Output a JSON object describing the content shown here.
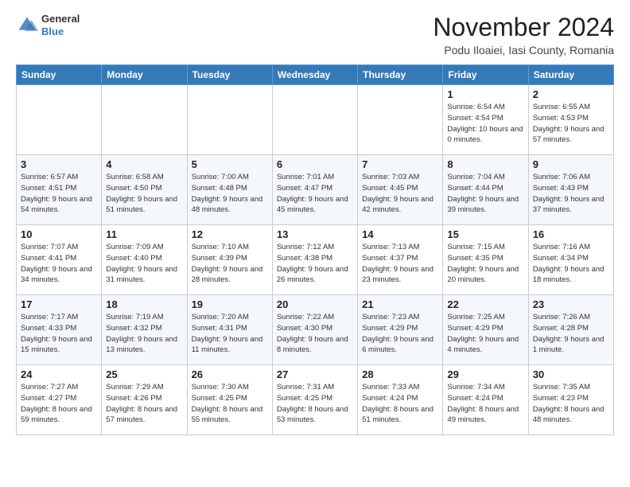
{
  "header": {
    "logo": {
      "general": "General",
      "blue": "Blue"
    },
    "title": "November 2024",
    "location": "Podu Iloaiei, Iasi County, Romania"
  },
  "days_of_week": [
    "Sunday",
    "Monday",
    "Tuesday",
    "Wednesday",
    "Thursday",
    "Friday",
    "Saturday"
  ],
  "weeks": [
    [
      {
        "day": "",
        "info": ""
      },
      {
        "day": "",
        "info": ""
      },
      {
        "day": "",
        "info": ""
      },
      {
        "day": "",
        "info": ""
      },
      {
        "day": "",
        "info": ""
      },
      {
        "day": "1",
        "info": "Sunrise: 6:54 AM\nSunset: 4:54 PM\nDaylight: 10 hours\nand 0 minutes."
      },
      {
        "day": "2",
        "info": "Sunrise: 6:55 AM\nSunset: 4:53 PM\nDaylight: 9 hours\nand 57 minutes."
      }
    ],
    [
      {
        "day": "3",
        "info": "Sunrise: 6:57 AM\nSunset: 4:51 PM\nDaylight: 9 hours\nand 54 minutes."
      },
      {
        "day": "4",
        "info": "Sunrise: 6:58 AM\nSunset: 4:50 PM\nDaylight: 9 hours\nand 51 minutes."
      },
      {
        "day": "5",
        "info": "Sunrise: 7:00 AM\nSunset: 4:48 PM\nDaylight: 9 hours\nand 48 minutes."
      },
      {
        "day": "6",
        "info": "Sunrise: 7:01 AM\nSunset: 4:47 PM\nDaylight: 9 hours\nand 45 minutes."
      },
      {
        "day": "7",
        "info": "Sunrise: 7:03 AM\nSunset: 4:45 PM\nDaylight: 9 hours\nand 42 minutes."
      },
      {
        "day": "8",
        "info": "Sunrise: 7:04 AM\nSunset: 4:44 PM\nDaylight: 9 hours\nand 39 minutes."
      },
      {
        "day": "9",
        "info": "Sunrise: 7:06 AM\nSunset: 4:43 PM\nDaylight: 9 hours\nand 37 minutes."
      }
    ],
    [
      {
        "day": "10",
        "info": "Sunrise: 7:07 AM\nSunset: 4:41 PM\nDaylight: 9 hours\nand 34 minutes."
      },
      {
        "day": "11",
        "info": "Sunrise: 7:09 AM\nSunset: 4:40 PM\nDaylight: 9 hours\nand 31 minutes."
      },
      {
        "day": "12",
        "info": "Sunrise: 7:10 AM\nSunset: 4:39 PM\nDaylight: 9 hours\nand 28 minutes."
      },
      {
        "day": "13",
        "info": "Sunrise: 7:12 AM\nSunset: 4:38 PM\nDaylight: 9 hours\nand 26 minutes."
      },
      {
        "day": "14",
        "info": "Sunrise: 7:13 AM\nSunset: 4:37 PM\nDaylight: 9 hours\nand 23 minutes."
      },
      {
        "day": "15",
        "info": "Sunrise: 7:15 AM\nSunset: 4:35 PM\nDaylight: 9 hours\nand 20 minutes."
      },
      {
        "day": "16",
        "info": "Sunrise: 7:16 AM\nSunset: 4:34 PM\nDaylight: 9 hours\nand 18 minutes."
      }
    ],
    [
      {
        "day": "17",
        "info": "Sunrise: 7:17 AM\nSunset: 4:33 PM\nDaylight: 9 hours\nand 15 minutes."
      },
      {
        "day": "18",
        "info": "Sunrise: 7:19 AM\nSunset: 4:32 PM\nDaylight: 9 hours\nand 13 minutes."
      },
      {
        "day": "19",
        "info": "Sunrise: 7:20 AM\nSunset: 4:31 PM\nDaylight: 9 hours\nand 11 minutes."
      },
      {
        "day": "20",
        "info": "Sunrise: 7:22 AM\nSunset: 4:30 PM\nDaylight: 9 hours\nand 8 minutes."
      },
      {
        "day": "21",
        "info": "Sunrise: 7:23 AM\nSunset: 4:29 PM\nDaylight: 9 hours\nand 6 minutes."
      },
      {
        "day": "22",
        "info": "Sunrise: 7:25 AM\nSunset: 4:29 PM\nDaylight: 9 hours\nand 4 minutes."
      },
      {
        "day": "23",
        "info": "Sunrise: 7:26 AM\nSunset: 4:28 PM\nDaylight: 9 hours\nand 1 minute."
      }
    ],
    [
      {
        "day": "24",
        "info": "Sunrise: 7:27 AM\nSunset: 4:27 PM\nDaylight: 8 hours\nand 59 minutes."
      },
      {
        "day": "25",
        "info": "Sunrise: 7:29 AM\nSunset: 4:26 PM\nDaylight: 8 hours\nand 57 minutes."
      },
      {
        "day": "26",
        "info": "Sunrise: 7:30 AM\nSunset: 4:25 PM\nDaylight: 8 hours\nand 55 minutes."
      },
      {
        "day": "27",
        "info": "Sunrise: 7:31 AM\nSunset: 4:25 PM\nDaylight: 8 hours\nand 53 minutes."
      },
      {
        "day": "28",
        "info": "Sunrise: 7:33 AM\nSunset: 4:24 PM\nDaylight: 8 hours\nand 51 minutes."
      },
      {
        "day": "29",
        "info": "Sunrise: 7:34 AM\nSunset: 4:24 PM\nDaylight: 8 hours\nand 49 minutes."
      },
      {
        "day": "30",
        "info": "Sunrise: 7:35 AM\nSunset: 4:23 PM\nDaylight: 8 hours\nand 48 minutes."
      }
    ]
  ]
}
